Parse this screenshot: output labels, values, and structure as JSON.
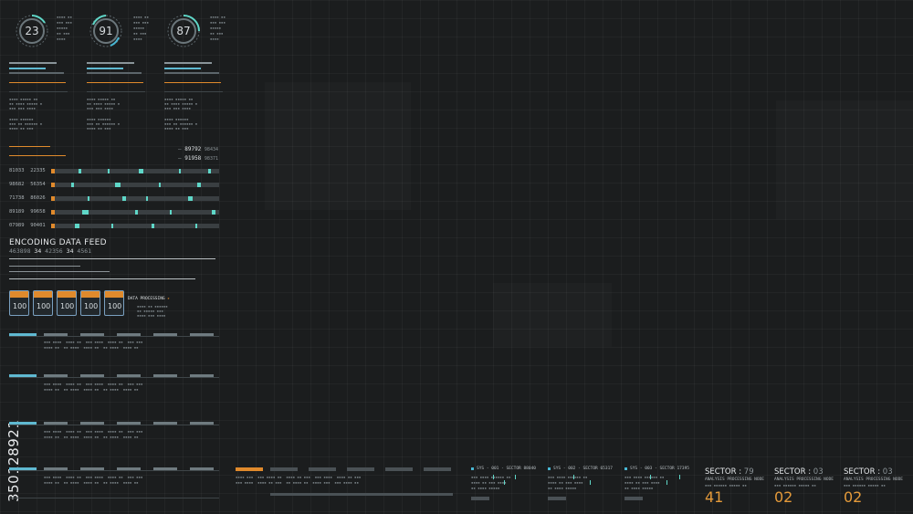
{
  "gauges": [
    {
      "value": "23",
      "label": "gauge-1"
    },
    {
      "value": "91",
      "label": "gauge-2"
    },
    {
      "value": "87",
      "label": "gauge-3"
    }
  ],
  "readouts": [
    {
      "primary": "89792",
      "secondary": "98434"
    },
    {
      "primary": "91958",
      "secondary": "98371"
    }
  ],
  "data_rows": [
    {
      "a": "81033",
      "b": "22335"
    },
    {
      "a": "98682",
      "b": "56354"
    },
    {
      "a": "71738",
      "b": "86026"
    },
    {
      "a": "89189",
      "b": "99658"
    },
    {
      "a": "07989",
      "b": "90401"
    }
  ],
  "encoding_feed": {
    "title": "ENCODING DATA FEED",
    "numbers_prefix": "463898",
    "numbers_bold_1": "34",
    "numbers_mid": "42356",
    "numbers_bold_2": "34",
    "numbers_suffix": "4561"
  },
  "cards": [
    {
      "value": "100"
    },
    {
      "value": "100"
    },
    {
      "value": "100"
    },
    {
      "value": "100"
    },
    {
      "value": "100"
    }
  ],
  "processing": {
    "label": "DATA PROCESSING"
  },
  "watermark_id": "350128921",
  "systems": [
    {
      "label": "SYS - 001 - SECTOR 88040"
    },
    {
      "label": "SYS - 002 - SECTOR 65317"
    },
    {
      "label": "SYS - 003 - SECTOR 17395"
    }
  ],
  "sectors": [
    {
      "title": "SECTOR",
      "code": "79",
      "sub": "ANALYSIS PROCESSING NODE",
      "big": "41"
    },
    {
      "title": "SECTOR",
      "code": "03",
      "sub": "ANALYSIS PROCESSING NODE",
      "big": "02"
    },
    {
      "title": "SECTOR",
      "code": "03",
      "sub": "ANALYSIS PROCESSING NODE",
      "big": "02"
    }
  ],
  "colors": {
    "background": "#1b1d1e",
    "accent_teal": "#5fd7c8",
    "accent_blue": "#48b7d4",
    "accent_orange": "#e49a3a"
  }
}
